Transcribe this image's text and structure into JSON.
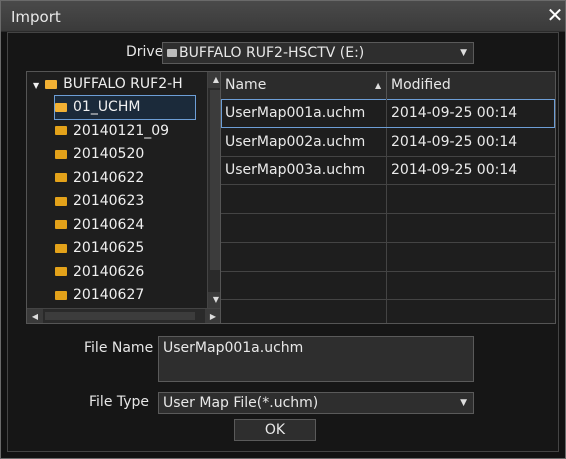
{
  "window": {
    "title": "Import",
    "close_label": "✕"
  },
  "drive": {
    "label": "Drive",
    "value": "BUFFALO RUF2-HSCTV (E:)",
    "icon": "drive-icon"
  },
  "tree": {
    "root": "BUFFALO RUF2-H",
    "items": [
      {
        "label": "01_UCHM",
        "selected": true
      },
      {
        "label": "20140121_09",
        "selected": false
      },
      {
        "label": "20140520",
        "selected": false
      },
      {
        "label": "20140622",
        "selected": false
      },
      {
        "label": "20140623",
        "selected": false
      },
      {
        "label": "20140624",
        "selected": false
      },
      {
        "label": "20140625",
        "selected": false
      },
      {
        "label": "20140626",
        "selected": false
      },
      {
        "label": "20140627",
        "selected": false
      }
    ]
  },
  "files": {
    "columns": [
      "Name",
      "Modified"
    ],
    "rows": [
      {
        "name": "UserMap001a.uchm",
        "modified": "2014-09-25 00:14",
        "selected": true
      },
      {
        "name": "UserMap002a.uchm",
        "modified": "2014-09-25 00:14",
        "selected": false
      },
      {
        "name": "UserMap003a.uchm",
        "modified": "2014-09-25 00:14",
        "selected": false
      }
    ]
  },
  "file_name": {
    "label": "File Name",
    "value": "UserMap001a.uchm"
  },
  "file_type": {
    "label": "File Type",
    "value": "User Map File(*.uchm)"
  },
  "ok_label": "OK",
  "colors": {
    "background": "#121212",
    "selection_outline": "#6d9ed6",
    "folder": "#e3a21a"
  }
}
